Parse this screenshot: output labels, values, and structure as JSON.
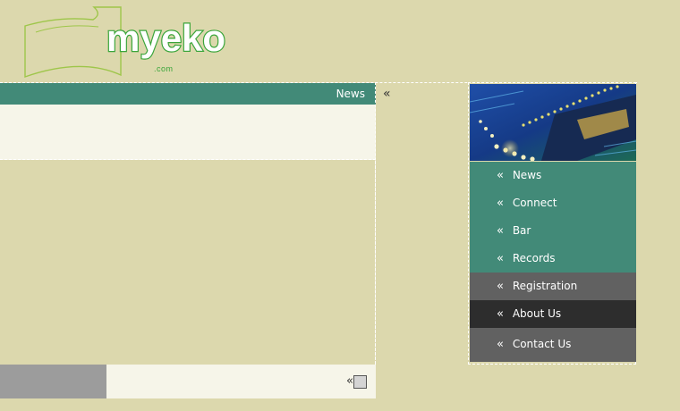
{
  "logo": {
    "name": "myeko",
    "domain": ".com"
  },
  "news_bar": {
    "title": "News"
  },
  "nav": {
    "items": [
      {
        "label": "News",
        "style": "teal"
      },
      {
        "label": "Connect",
        "style": "teal"
      },
      {
        "label": "Bar",
        "style": "teal"
      },
      {
        "label": "Records",
        "style": "teal"
      },
      {
        "label": "Registration",
        "style": "gray"
      },
      {
        "label": "About Us",
        "style": "dark"
      },
      {
        "label": "Contact Us",
        "style": "gray"
      }
    ]
  },
  "glyphs": {
    "chevron": "«"
  },
  "colors": {
    "background": "#dcd8ad",
    "teal": "#428a78",
    "gray": "#616161",
    "dark": "#2d2d2d",
    "cream": "#f6f5e9",
    "logo_green": "#3aa53a"
  },
  "icons": {
    "sidebar_image": "circuit-board-image",
    "footer": "square-icon"
  }
}
